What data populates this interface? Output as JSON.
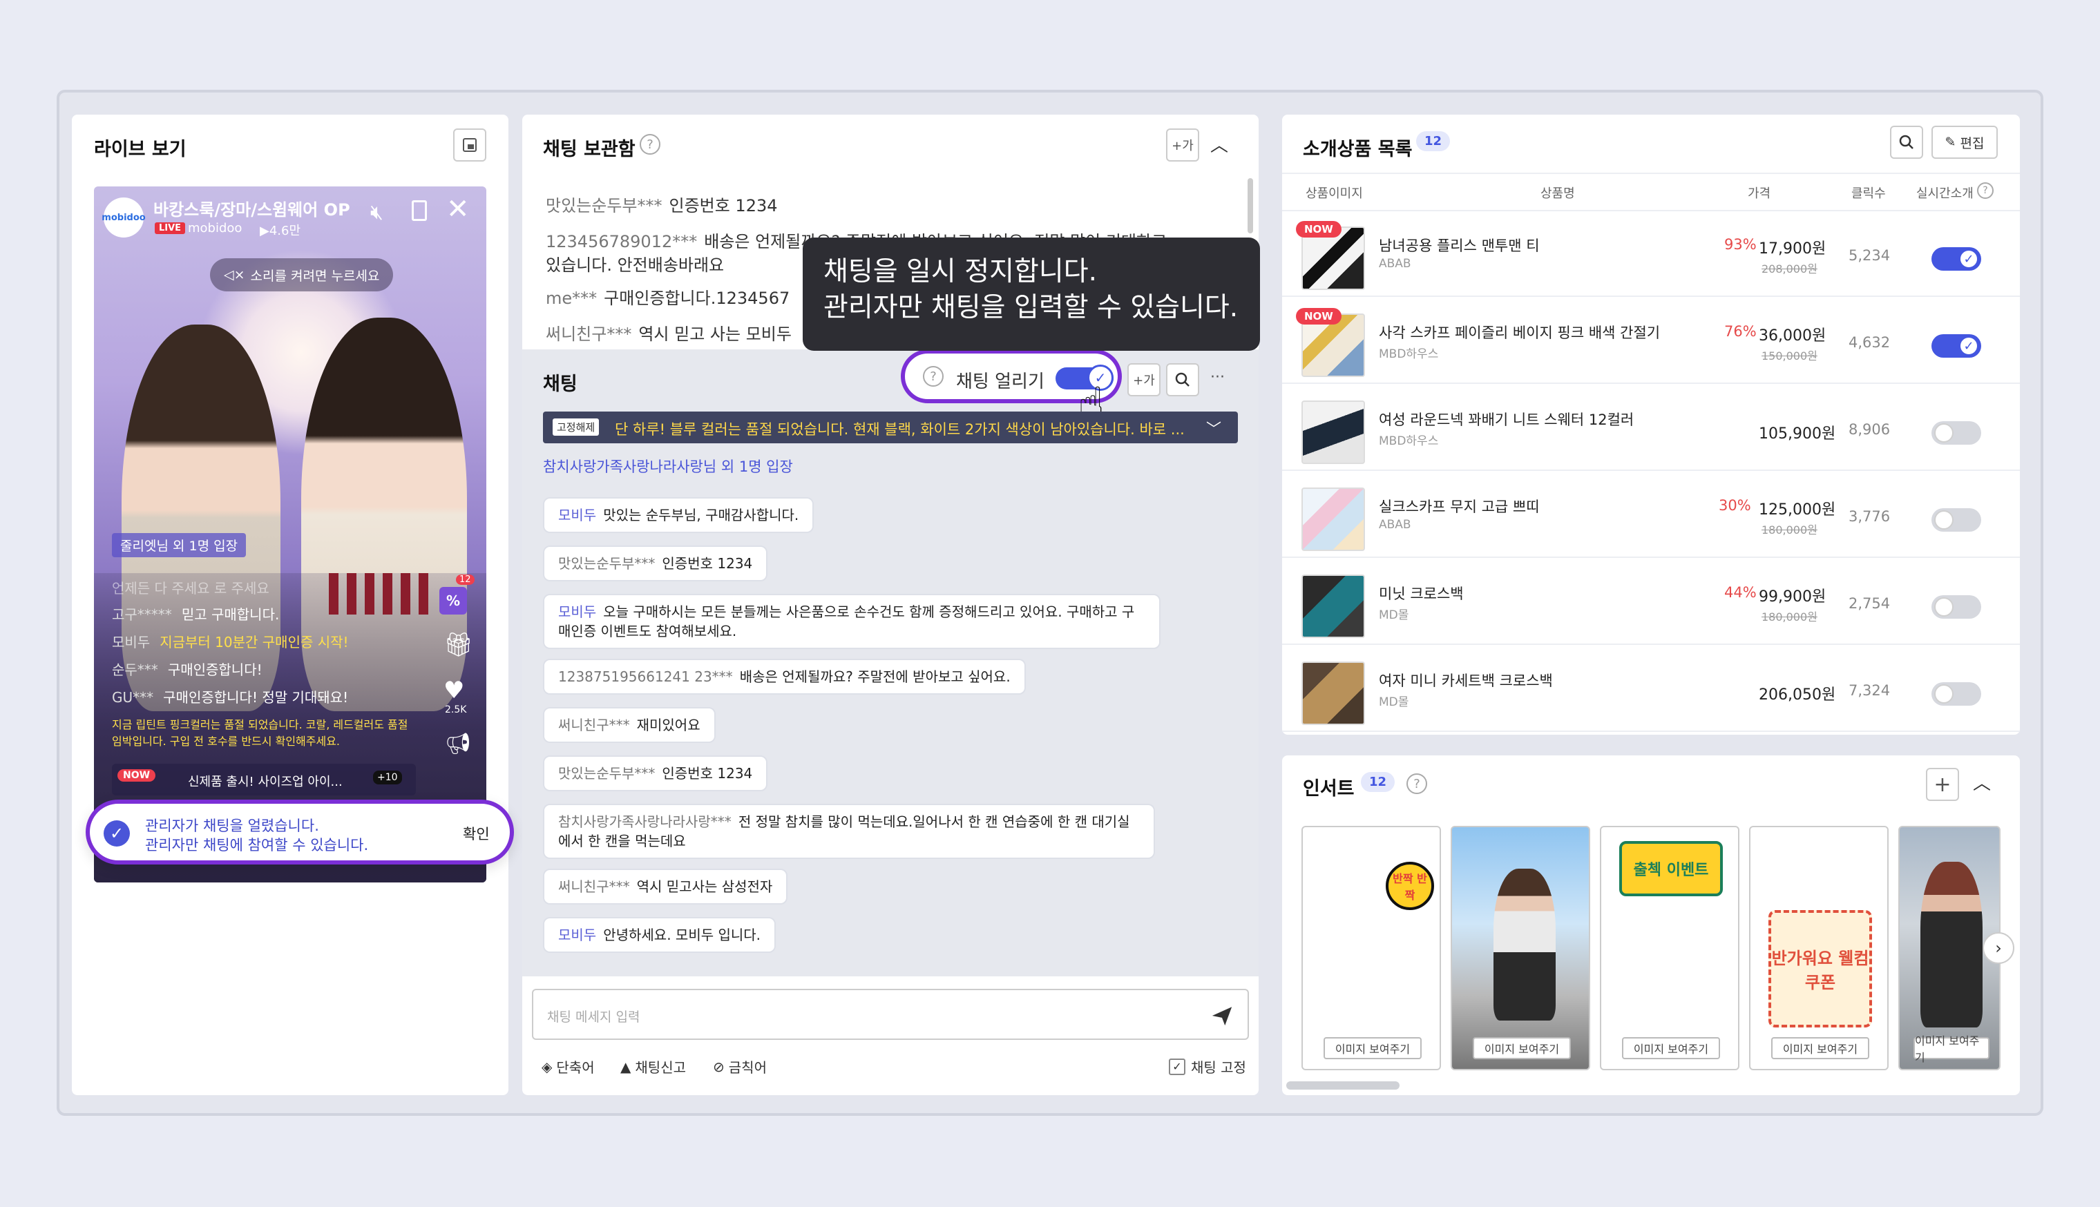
{
  "live": {
    "title": "라이브 보기",
    "channel_title": "바캉스룩/장마/스윔웨어 OP",
    "badge_live": "LIVE",
    "channel_name": "mobidoo",
    "viewers": "▶4.6만",
    "logo_text": "mobidoo",
    "unmute_hint": "소리를 켜려면 누르세요",
    "entry": "줄리엣님 외 1명 입장",
    "chats": [
      {
        "user": "",
        "text": "언제든 다 주세요 로 주세요"
      },
      {
        "user": "고구*****",
        "text": "믿고 구매합니다."
      },
      {
        "user": "모비두",
        "text": "지금부터 10분간 구매인증 시작!"
      },
      {
        "user": "순두***",
        "text": "구매인증합니다!"
      },
      {
        "user": "GU***",
        "text": "구매인증합니다! 정말 기대돼요!"
      }
    ],
    "notice": "지금 립틴트 핑크컬러는 품절 되었습니다. 코랄, 레드컬러도 품절 임박입니다. 구입 전 호수를 반드시 확인해주세요.",
    "now_label": "NOW",
    "now_product": "신제품 출시! 사이즈업 아이...",
    "discount_badge": "%",
    "discount_count": "12",
    "like_count": "2.5K",
    "more_count": "+10",
    "toast_line1": "관리자가 채팅을 얼렸습니다.",
    "toast_line2": "관리자만 채팅에 참여할 수 있습니다.",
    "toast_confirm": "확인"
  },
  "archive": {
    "title": "채팅 보관함",
    "font_button": "+가",
    "lines": [
      {
        "user": "맛있는순두부***",
        "text": "인증번호 1234"
      },
      {
        "user": "123456789012***",
        "text": "배송은 언제될까요? 주말전에 받아보고 싶어요. 정말 많이 기대하고"
      },
      {
        "user": "",
        "text": "있습니다. 안전배송바래요"
      },
      {
        "user": "me***",
        "text": "구매인증합니다.1234567"
      },
      {
        "user": "써니친구***",
        "text": "역시 믿고 사는 모비두"
      }
    ]
  },
  "tooltip": {
    "line1": "채팅을 일시 정지합니다.",
    "line2": "관리자만 채팅을 입력할 수 있습니다."
  },
  "chat": {
    "title": "채팅",
    "freeze_label": "채팅 얼리기",
    "font_button": "+가",
    "more": "···",
    "pinned_tag": "고정해제",
    "pinned_text": "단 하루! 블루 컬러는 품절 되었습니다. 현재 블랙, 화이트 2가지 색상이 남아있습니다. 바로 ...",
    "entry": "참치사랑가족사랑나라사랑님 외 1명 입장",
    "messages": [
      {
        "user": "모비두",
        "text": "맛있는 순두부님, 구매감사합니다.",
        "admin": true
      },
      {
        "user": "맛있는순두부***",
        "text": "인증번호 1234",
        "admin": false
      },
      {
        "user": "모비두",
        "text": "오늘 구매하시는 모든 분들께는 사은품으로 손수건도 함께 증정해드리고 있어요. 구매하고 구매인증 이벤트도 참여해보세요.",
        "admin": true
      },
      {
        "user": "123875195661241 23***",
        "text": "배송은 언제될까요? 주말전에 받아보고 싶어요.",
        "admin": false
      },
      {
        "user": "써니친구***",
        "text": "재미있어요",
        "admin": false
      },
      {
        "user": "맛있는순두부***",
        "text": "인증번호 1234",
        "admin": false
      },
      {
        "user": "참치사랑가족사랑나라사랑***",
        "text": "전 정말 참치를 많이 먹는데요.일어나서 한 캔 연습중에 한 캔 대기실에서 한 캔을 먹는데요",
        "admin": false
      },
      {
        "user": "써니친구***",
        "text": "역시 믿고사는 삼성전자",
        "admin": false
      },
      {
        "user": "모비두",
        "text": "안녕하세요. 모비두 입니다.",
        "admin": true
      }
    ],
    "input_placeholder": "채팅 메세지 입력",
    "tools": {
      "shortcut": "단축어",
      "report": "채팅신고",
      "banned": "금칙어",
      "pin": "채팅 고정"
    }
  },
  "products": {
    "title": "소개상품 목록",
    "count": "12",
    "edit_label": "편집",
    "columns": [
      "상품이미지",
      "상품명",
      "가격",
      "클릭수",
      "실시간소개"
    ],
    "items": [
      {
        "name": "남녀공용 플리스 맨투맨 티",
        "brand": "ABAB",
        "discount": "93%",
        "price": "17,900원",
        "original": "208,000원",
        "clicks": "5,234",
        "live": true,
        "now": "NOW"
      },
      {
        "name": "사각 스카프 페이즐리 베이지 핑크 배색 간절기",
        "brand": "MBD하우스",
        "discount": "76%",
        "price": "36,000원",
        "original": "150,000원",
        "clicks": "4,632",
        "live": true,
        "now": "NOW"
      },
      {
        "name": "여성 라운드넥 꽈배기 니트 스웨터 12컬러",
        "brand": "MBD하우스",
        "discount": "",
        "price": "105,900원",
        "original": "",
        "clicks": "8,906",
        "live": false,
        "now": ""
      },
      {
        "name": "실크스카프 무지 고급 쁘띠",
        "brand": "ABAB",
        "discount": "30%",
        "price": "125,000원",
        "original": "180,000원",
        "clicks": "3,776",
        "live": false,
        "now": ""
      },
      {
        "name": "미닛 크로스백",
        "brand": "MD몰",
        "discount": "44%",
        "price": "99,900원",
        "original": "180,000원",
        "clicks": "2,754",
        "live": false,
        "now": ""
      },
      {
        "name": "여자 미니 카세트백 크로스백",
        "brand": "MD몰",
        "discount": "",
        "price": "206,050원",
        "original": "",
        "clicks": "7,324",
        "live": false,
        "now": ""
      }
    ]
  },
  "insert": {
    "title": "인서트",
    "count": "12",
    "show_button": "이미지 보여주기",
    "stickers": [
      "반짝 반짝",
      "",
      "출첵 이벤트",
      "반가워요 웰컴쿠폰",
      ""
    ]
  },
  "colors": {
    "accent": "#4356e0",
    "highlight": "#7b2fd6",
    "discount": "#e64a4a",
    "pinned_bg": "#3f4460"
  }
}
